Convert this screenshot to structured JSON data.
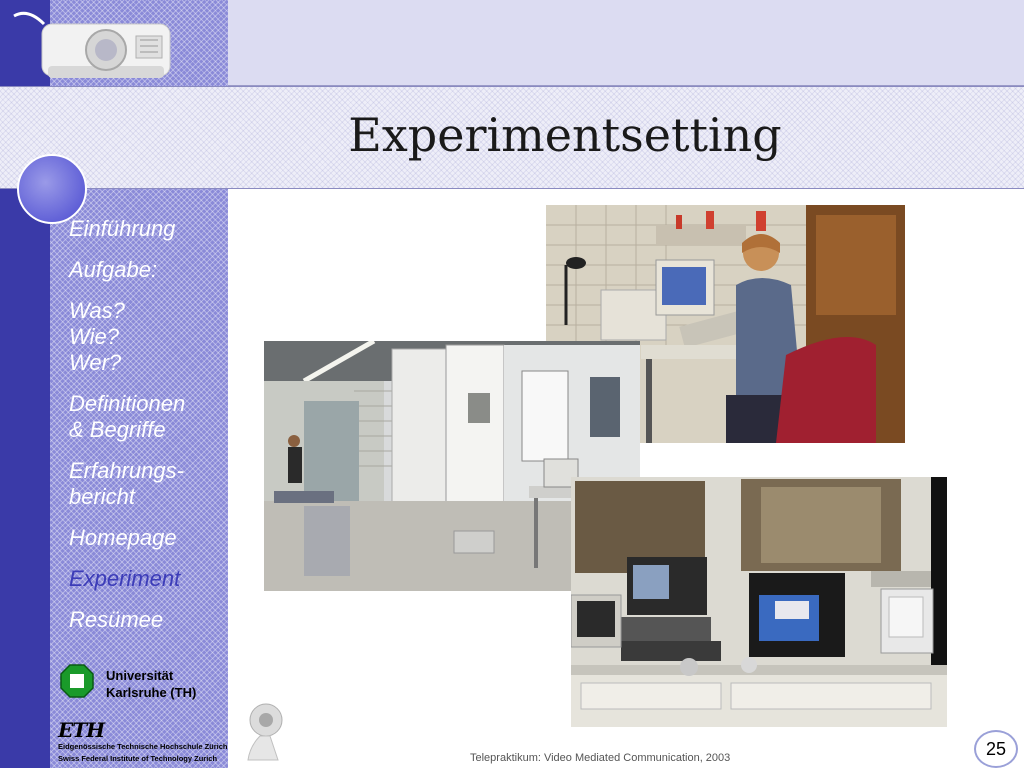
{
  "slide": {
    "title": "Experimentsetting",
    "footer": "Telepraktikum: Video Mediated Communication, 2003",
    "page_number": "25"
  },
  "nav": {
    "items": [
      {
        "label": "Einführung",
        "active": false
      },
      {
        "label": "Aufgabe:",
        "active": false
      },
      {
        "label": "Was?\nWie?\nWer?",
        "active": false
      },
      {
        "label": "Definitionen\n& Begriffe",
        "active": false
      },
      {
        "label": "Erfahrungs-\nbericht",
        "active": false
      },
      {
        "label": "Homepage",
        "active": false
      },
      {
        "label": "Experiment",
        "active": true
      },
      {
        "label": "Resümee",
        "active": false
      }
    ]
  },
  "logos": {
    "uka_line1": "Universität",
    "uka_line2": "Karlsruhe (TH)",
    "eth_mark": "ETH",
    "eth_line1": "Eidgenössische Technische Hochschule Zürich",
    "eth_line2": "Swiss Federal Institute of Technology Zurich"
  },
  "icons": {
    "projector": "projector-icon",
    "webcam": "webcam-icon"
  },
  "colors": {
    "sidebar_dark": "#3a3aa8",
    "sidebar_pattern": "#8a8ad8",
    "nav_text": "#ffffff",
    "nav_active": "#3c3cb8"
  }
}
